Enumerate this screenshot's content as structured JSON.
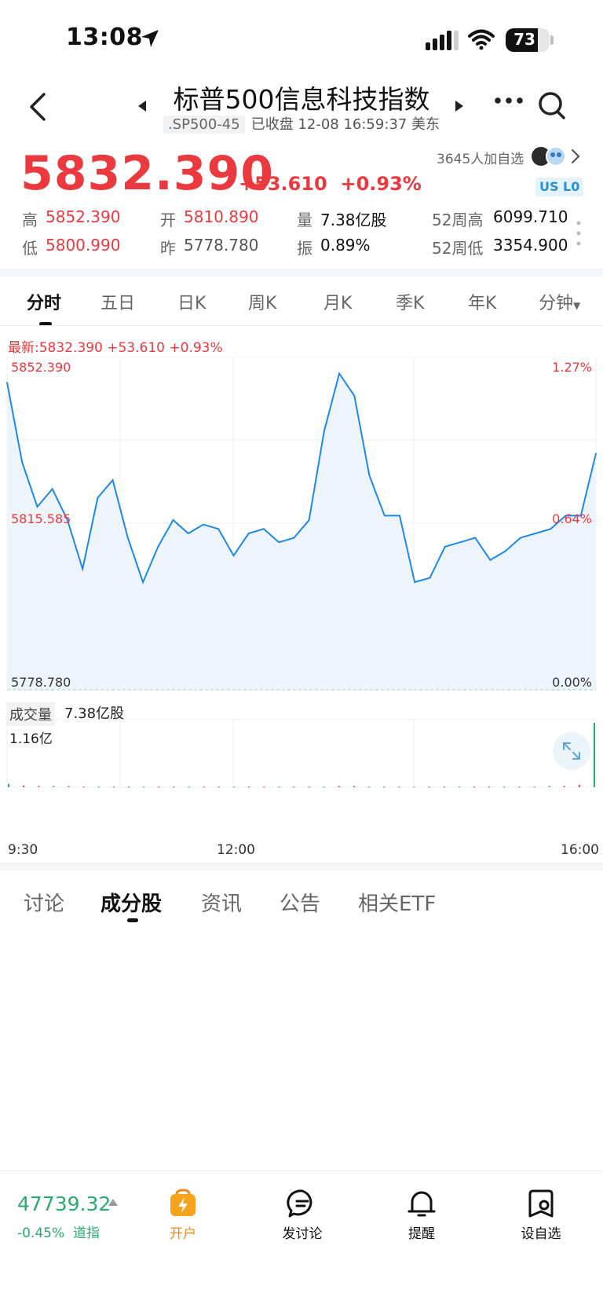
{
  "status_bar": {
    "time": "13:08",
    "battery": "73",
    "battery_level": 0.73
  },
  "header": {
    "title": "标普500信息科技指数",
    "code": ".SP500-45",
    "status": "已收盘 12-08 16:59:37 美东"
  },
  "quote": {
    "price": "5832.390",
    "change": "+53.610",
    "change_pct": "+0.93%",
    "followers": "3645人加自选",
    "badges": [
      "US",
      "L0"
    ],
    "stats": {
      "high_label": "高",
      "high": "5852.390",
      "open_label": "开",
      "open": "5810.890",
      "volume_label": "量",
      "volume": "7.38亿股",
      "high52_label": "52周高",
      "high52": "6099.710",
      "low_label": "低",
      "low": "5800.990",
      "prev_label": "昨",
      "prev": "5778.780",
      "amp_label": "振",
      "amp": "0.89%",
      "low52_label": "52周低",
      "low52": "3354.900"
    }
  },
  "chart_tabs": [
    "分时",
    "五日",
    "日K",
    "周K",
    "月K",
    "季K",
    "年K",
    "分钟"
  ],
  "active_chart_tab": 0,
  "latest_line": "最新:5832.390  +53.610  +0.93%",
  "chart_labels": {
    "y_top": "5852.390",
    "y_mid": "5815.585",
    "y_bottom": "5778.780",
    "pct_top": "1.27%",
    "pct_mid": "0.64%",
    "pct_bottom": "0.00%",
    "volume_label": "成交量",
    "volume_total": "7.38亿股",
    "volume_max": "1.16亿",
    "x_start": "9:30",
    "x_mid": "12:00",
    "x_end": "16:00"
  },
  "chart_data": {
    "type": "line",
    "xlabel": "",
    "ylabel": "",
    "x_ticks": [
      "9:30",
      "12:00",
      "16:00"
    ],
    "ylim": [
      5778.78,
      5852.39
    ],
    "series": [
      {
        "x": [
          "9:30",
          "9:40",
          "9:50",
          "10:00",
          "10:10",
          "10:20",
          "10:30",
          "10:40",
          "10:50",
          "11:00",
          "11:10",
          "11:20",
          "11:30",
          "11:40",
          "11:50",
          "12:00",
          "12:10",
          "12:20",
          "12:30",
          "12:40",
          "12:50",
          "13:00",
          "13:10",
          "13:20",
          "13:30",
          "13:40",
          "13:50",
          "14:00",
          "14:10",
          "14:20",
          "14:30",
          "14:40",
          "14:50",
          "15:00",
          "15:10",
          "15:20",
          "15:30",
          "15:40",
          "15:50",
          "16:00"
        ],
        "y": [
          5848,
          5830,
          5820,
          5824,
          5817,
          5806,
          5822,
          5826,
          5813,
          5803,
          5811,
          5817,
          5814,
          5816,
          5815,
          5809,
          5814,
          5815,
          5812,
          5813,
          5817,
          5837,
          5850,
          5845,
          5827,
          5818,
          5818,
          5803,
          5804,
          5811,
          5812,
          5813,
          5808,
          5810,
          5813,
          5814,
          5815,
          5818,
          5818,
          5832
        ]
      }
    ],
    "volume": {
      "max": "1.16亿",
      "note_values": [
        0.06,
        0.03,
        0.02,
        0.02,
        0.02,
        0.01,
        0.01,
        0.01,
        0.01,
        0.01,
        0.01,
        0.01,
        0.01,
        0.01,
        0.01,
        0.01,
        0.01,
        0.01,
        0.01,
        0.01,
        0.01,
        0.01,
        0.02,
        0.02,
        0.01,
        0.01,
        0.01,
        0.01,
        0.01,
        0.01,
        0.01,
        0.01,
        0.01,
        0.01,
        0.01,
        0.01,
        0.02,
        0.02,
        0.04,
        1.16
      ]
    }
  },
  "colors": {
    "up": "#ea3a3f",
    "down": "#2aaa6b",
    "line": "#1e88e5",
    "fill": "#eef4fc"
  },
  "bottom_tabs": [
    "讨论",
    "成分股",
    "资讯",
    "公告",
    "相关ETF"
  ],
  "active_bottom_tab": 1,
  "bottom_bar": {
    "index_value": "47739.32",
    "index_change": "-0.45%",
    "index_name": "道指",
    "items": [
      {
        "label": "开户",
        "icon": "lightning-bag-icon"
      },
      {
        "label": "发讨论",
        "icon": "chat-icon"
      },
      {
        "label": "提醒",
        "icon": "bell-icon"
      },
      {
        "label": "设自选",
        "icon": "watchlist-gear-icon"
      }
    ]
  }
}
